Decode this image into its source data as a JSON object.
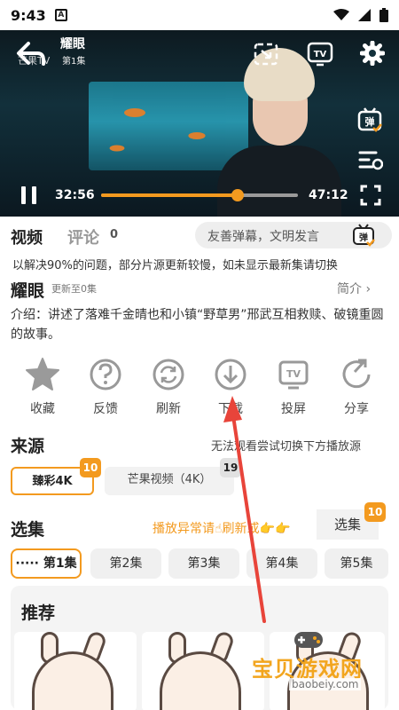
{
  "status": {
    "time": "9:43",
    "app_badge": "A"
  },
  "player": {
    "title": "耀眼",
    "subtitle": "第1集",
    "watermark": "芒果TV",
    "current_time": "32:56",
    "duration": "47:12",
    "progress": 0.693
  },
  "tabs": {
    "video": "视频",
    "comment": "评论",
    "comment_count": "0"
  },
  "danmu": {
    "placeholder": "友善弹幕，文明发言",
    "icon_label": "弹"
  },
  "notice": "以解决90%的问题，部分片源更新较慢，如未显示最新集请切换",
  "show": {
    "title": "耀眼",
    "updated": "更新至0集",
    "intro_link": "简介 ›",
    "description": "介绍：讲述了落难千金晴也和小镇“野草男”邢武互相救赎、破镜重圆的故事。"
  },
  "actions": [
    {
      "label": "收藏",
      "icon": "star-icon"
    },
    {
      "label": "反馈",
      "icon": "question-icon"
    },
    {
      "label": "刷新",
      "icon": "refresh-icon"
    },
    {
      "label": "下载",
      "icon": "download-icon"
    },
    {
      "label": "投屏",
      "icon": "tv-cast-icon"
    },
    {
      "label": "分享",
      "icon": "share-icon"
    }
  ],
  "source": {
    "heading": "来源",
    "tip": "无法观看尝试切换下方播放源",
    "options": [
      {
        "label": "臻彩4K",
        "badge": "10"
      },
      {
        "label": "芒果视频（4K）",
        "badge": "19"
      }
    ]
  },
  "episodes": {
    "heading": "选集",
    "tip": "播放异常请☝刷新或👉👉",
    "select_label": "选集",
    "select_badge": "10",
    "list": [
      "第1集",
      "第2集",
      "第3集",
      "第4集",
      "第5集"
    ],
    "active_prefix": "·····"
  },
  "recommend": {
    "heading": "推荐"
  },
  "site_watermark": {
    "name": "宝贝游戏网",
    "url": "baobeiy.com"
  },
  "colors": {
    "accent": "#f39a1f",
    "player_bg": "#12303b"
  }
}
